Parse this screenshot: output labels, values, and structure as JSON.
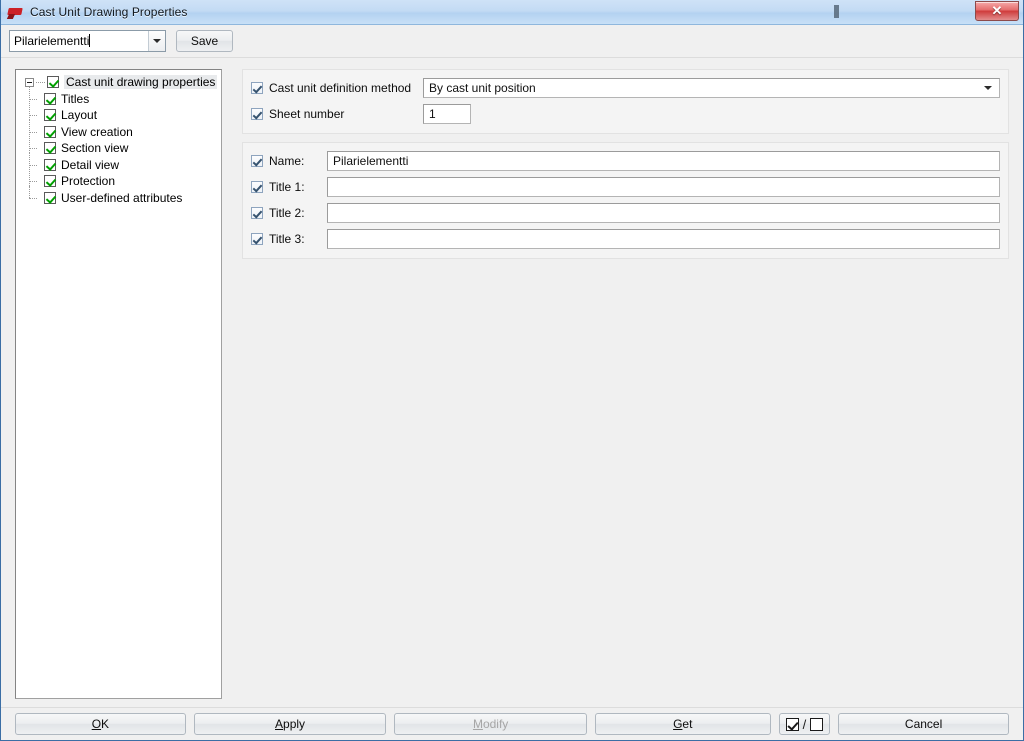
{
  "window": {
    "title": "Cast Unit Drawing Properties",
    "icon": "tekla-logo-icon",
    "close_label": "✕",
    "accent_color": "#3b6ea5",
    "titlebar_color": "#c3dbf4",
    "close_button_color": "#cf3a3a"
  },
  "toolbar": {
    "combo_value": "Pilarielementti",
    "combo_placeholder": "",
    "save_label": "Save"
  },
  "tree": {
    "root": {
      "label": "Cast unit drawing properties",
      "checked": true,
      "expanded": true
    },
    "items": [
      {
        "label": "Titles",
        "checked": true
      },
      {
        "label": "Layout",
        "checked": true
      },
      {
        "label": "View creation",
        "checked": true
      },
      {
        "label": "Section view",
        "checked": true
      },
      {
        "label": "Detail view",
        "checked": true
      },
      {
        "label": "Protection",
        "checked": true
      },
      {
        "label": "User-defined attributes",
        "checked": true
      }
    ],
    "check_color": "#00a000"
  },
  "main": {
    "group_top": {
      "method": {
        "label": "Cast unit definition method",
        "checked": true,
        "value": "By cast unit position",
        "options": [
          "By cast unit position"
        ]
      },
      "sheet": {
        "label": "Sheet number",
        "checked": true,
        "value": "1",
        "placeholder": ""
      }
    },
    "group_titles": {
      "rows": [
        {
          "label": "Name:",
          "checked": true,
          "value": "Pilarielementti",
          "placeholder": ""
        },
        {
          "label": "Title 1:",
          "checked": true,
          "value": "",
          "placeholder": ""
        },
        {
          "label": "Title 2:",
          "checked": true,
          "value": "",
          "placeholder": ""
        },
        {
          "label": "Title 3:",
          "checked": true,
          "value": "",
          "placeholder": ""
        }
      ]
    }
  },
  "buttons": {
    "ok": {
      "label": "OK",
      "accel": "O",
      "enabled": true
    },
    "apply": {
      "label": "Apply",
      "accel": "A",
      "enabled": true
    },
    "modify": {
      "label": "Modify",
      "accel": "M",
      "enabled": false
    },
    "get": {
      "label": "Get",
      "accel": "G",
      "enabled": true
    },
    "toggle": {
      "label": "",
      "checked_box": true,
      "separator": "/",
      "unchecked_box": true
    },
    "cancel": {
      "label": "Cancel",
      "accel": "",
      "enabled": true
    }
  }
}
